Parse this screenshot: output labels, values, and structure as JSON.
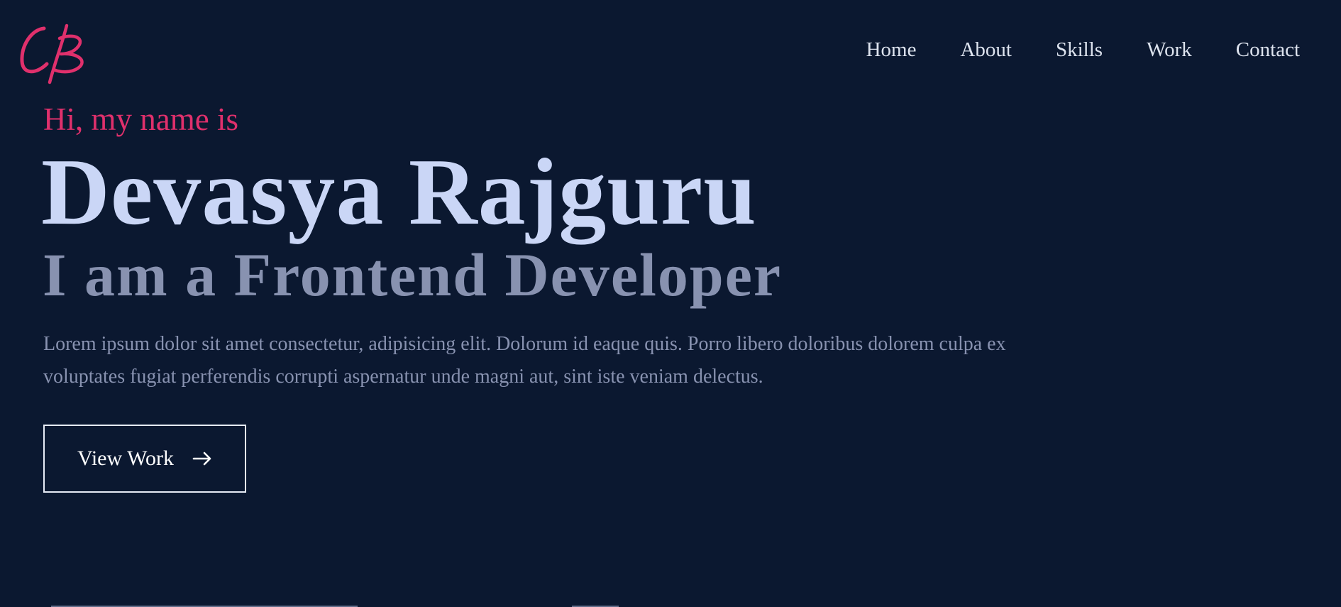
{
  "brand": {
    "logo_initials": "CB",
    "accent_color": "#e0306c",
    "logo_icon": "handwritten-initials-logo"
  },
  "nav": {
    "items": [
      {
        "label": "Home"
      },
      {
        "label": "About"
      },
      {
        "label": "Skills"
      },
      {
        "label": "Work"
      },
      {
        "label": "Contact"
      }
    ]
  },
  "hero": {
    "greeting": "Hi, my name is",
    "name": "Devasya Rajguru",
    "role": "I am a Frontend Developer",
    "intro": "Lorem ipsum dolor sit amet consectetur, adipisicing elit. Dolorum id eaque quis. Porro libero doloribus dolorem culpa ex voluptates fugiat perferendis corrupti aspernatur unde magni aut, sint iste veniam delectus.",
    "cta": {
      "label": "View Work",
      "icon": "arrow-right-icon"
    }
  },
  "colors": {
    "background": "#0b1830",
    "name_text": "#cad6f6",
    "secondary_text": "#8892b0",
    "nav_text": "#dde3ee"
  }
}
